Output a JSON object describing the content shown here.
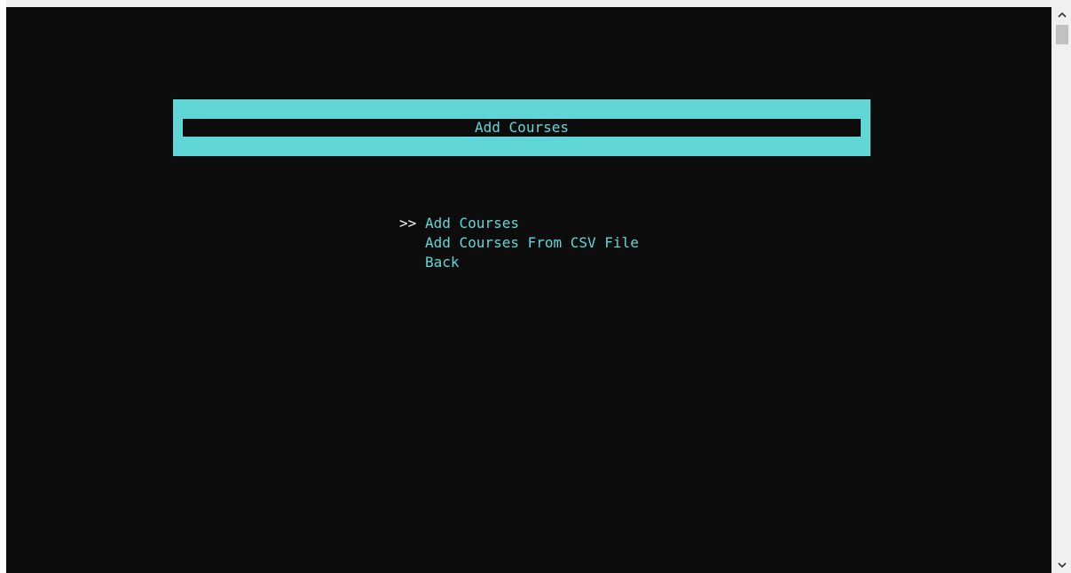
{
  "title_banner": {
    "text": "Add Courses"
  },
  "menu": {
    "cursor": ">>",
    "items": [
      {
        "label": "Add Courses",
        "selected": true
      },
      {
        "label": "Add Courses From CSV File",
        "selected": false
      },
      {
        "label": "Back",
        "selected": false
      }
    ]
  },
  "colors": {
    "background": "#0c0c0c",
    "accent": "#61d6d6",
    "cursor": "#f2f2f2"
  },
  "scrollbar": {
    "up_icon": "chevron-up-icon",
    "down_icon": "chevron-down-icon"
  }
}
